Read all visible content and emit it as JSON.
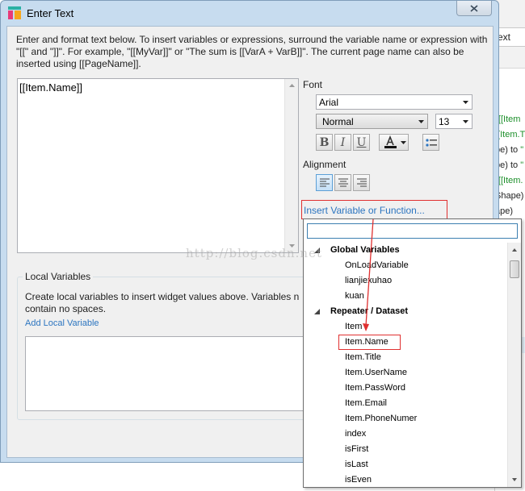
{
  "window": {
    "title": "Enter Text"
  },
  "intro": "Enter and format text below. To insert variables or expressions, surround the variable name or expression with \"[[\" and \"]]\". For example, \"[[MyVar]]\" or \"The sum is [[VarA + VarB]]\". The current page name can also be inserted using [[PageName]].",
  "editor": {
    "text": "[[Item.Name]]"
  },
  "font": {
    "label": "Font",
    "family": "Arial",
    "weight": "Normal",
    "size": "13",
    "bold": "B",
    "italic": "I",
    "underline": "U"
  },
  "alignment": {
    "label": "Alignment"
  },
  "insert_link": "Insert Variable or Function...",
  "local_variables": {
    "legend": "Local Variables",
    "description": "Create local variables to insert widget values above. Variables n contain no spaces.",
    "add_link": "Add Local Variable"
  },
  "popup": {
    "search_value": "",
    "groups": [
      {
        "name": "Global Variables",
        "items": [
          "OnLoadVariable",
          "lianjiexuhao",
          "kuan"
        ]
      },
      {
        "name": "Repeater / Dataset",
        "items": [
          "Item",
          "Item.Name",
          "Item.Title",
          "Item.UserName",
          "Item.PassWord",
          "Item.Email",
          "Item.PhoneNumer",
          "index",
          "isFirst",
          "isLast",
          "isEven"
        ]
      }
    ],
    "highlighted_item": "Item.Name"
  },
  "watermark": "http://blog.csdn.net",
  "background": {
    "input_text": "ext",
    "lines": [
      {
        "plain": "",
        "green": "\"[[Item"
      },
      {
        "plain": "",
        "green": "[[Item.T"
      },
      {
        "plain": "pe) to ",
        "green": "\""
      },
      {
        "plain": "pe) to ",
        "green": "\""
      },
      {
        "plain": "",
        "green": "\"[[Item."
      },
      {
        "plain": "Shape)",
        "green": ""
      },
      {
        "plain": "ape)",
        "green": ""
      }
    ]
  },
  "colors": {
    "accent": "#2c75c0",
    "highlight_border": "#e03030",
    "window_frame": "#c7dcef"
  }
}
